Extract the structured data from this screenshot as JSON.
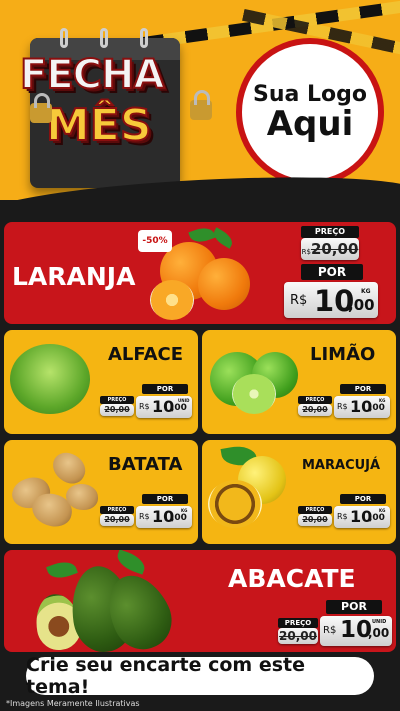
{
  "header": {
    "title_line1": "FECHA",
    "title_line2": "MÊS",
    "logo_line1": "Sua Logo",
    "logo_line2": "Aqui"
  },
  "labels": {
    "preco": "PREÇO",
    "por": "POR",
    "currency": "R$"
  },
  "featured": {
    "name": "LARANJA",
    "discount": "-50%",
    "old_price": "20,00",
    "price_int": "10",
    "price_dec": ",00",
    "unit": "KG"
  },
  "products": [
    {
      "name": "ALFACE",
      "old_price": "20,00",
      "price_int": "10",
      "price_dec": ",00",
      "unit": "UNID"
    },
    {
      "name": "LIMÃO",
      "old_price": "20,00",
      "price_int": "10",
      "price_dec": ",00",
      "unit": "KG"
    },
    {
      "name": "BATATA",
      "old_price": "20,00",
      "price_int": "10",
      "price_dec": ",00",
      "unit": "KG"
    },
    {
      "name": "MARACUJÁ",
      "old_price": "20,00",
      "price_int": "10",
      "price_dec": ",00",
      "unit": "KG"
    }
  ],
  "bottom": {
    "name": "ABACATE",
    "old_price": "20,00",
    "price_int": "10",
    "price_dec": ",00",
    "unit": "UNID"
  },
  "cta": "Crie seu encarte com este tema!",
  "disclaimer": "*Imagens Meramente Ilustrativas",
  "colors": {
    "red": "#c8151b",
    "yellow": "#f5b512",
    "orange_bg": "#f6ad17",
    "dark": "#1a1a1a"
  }
}
